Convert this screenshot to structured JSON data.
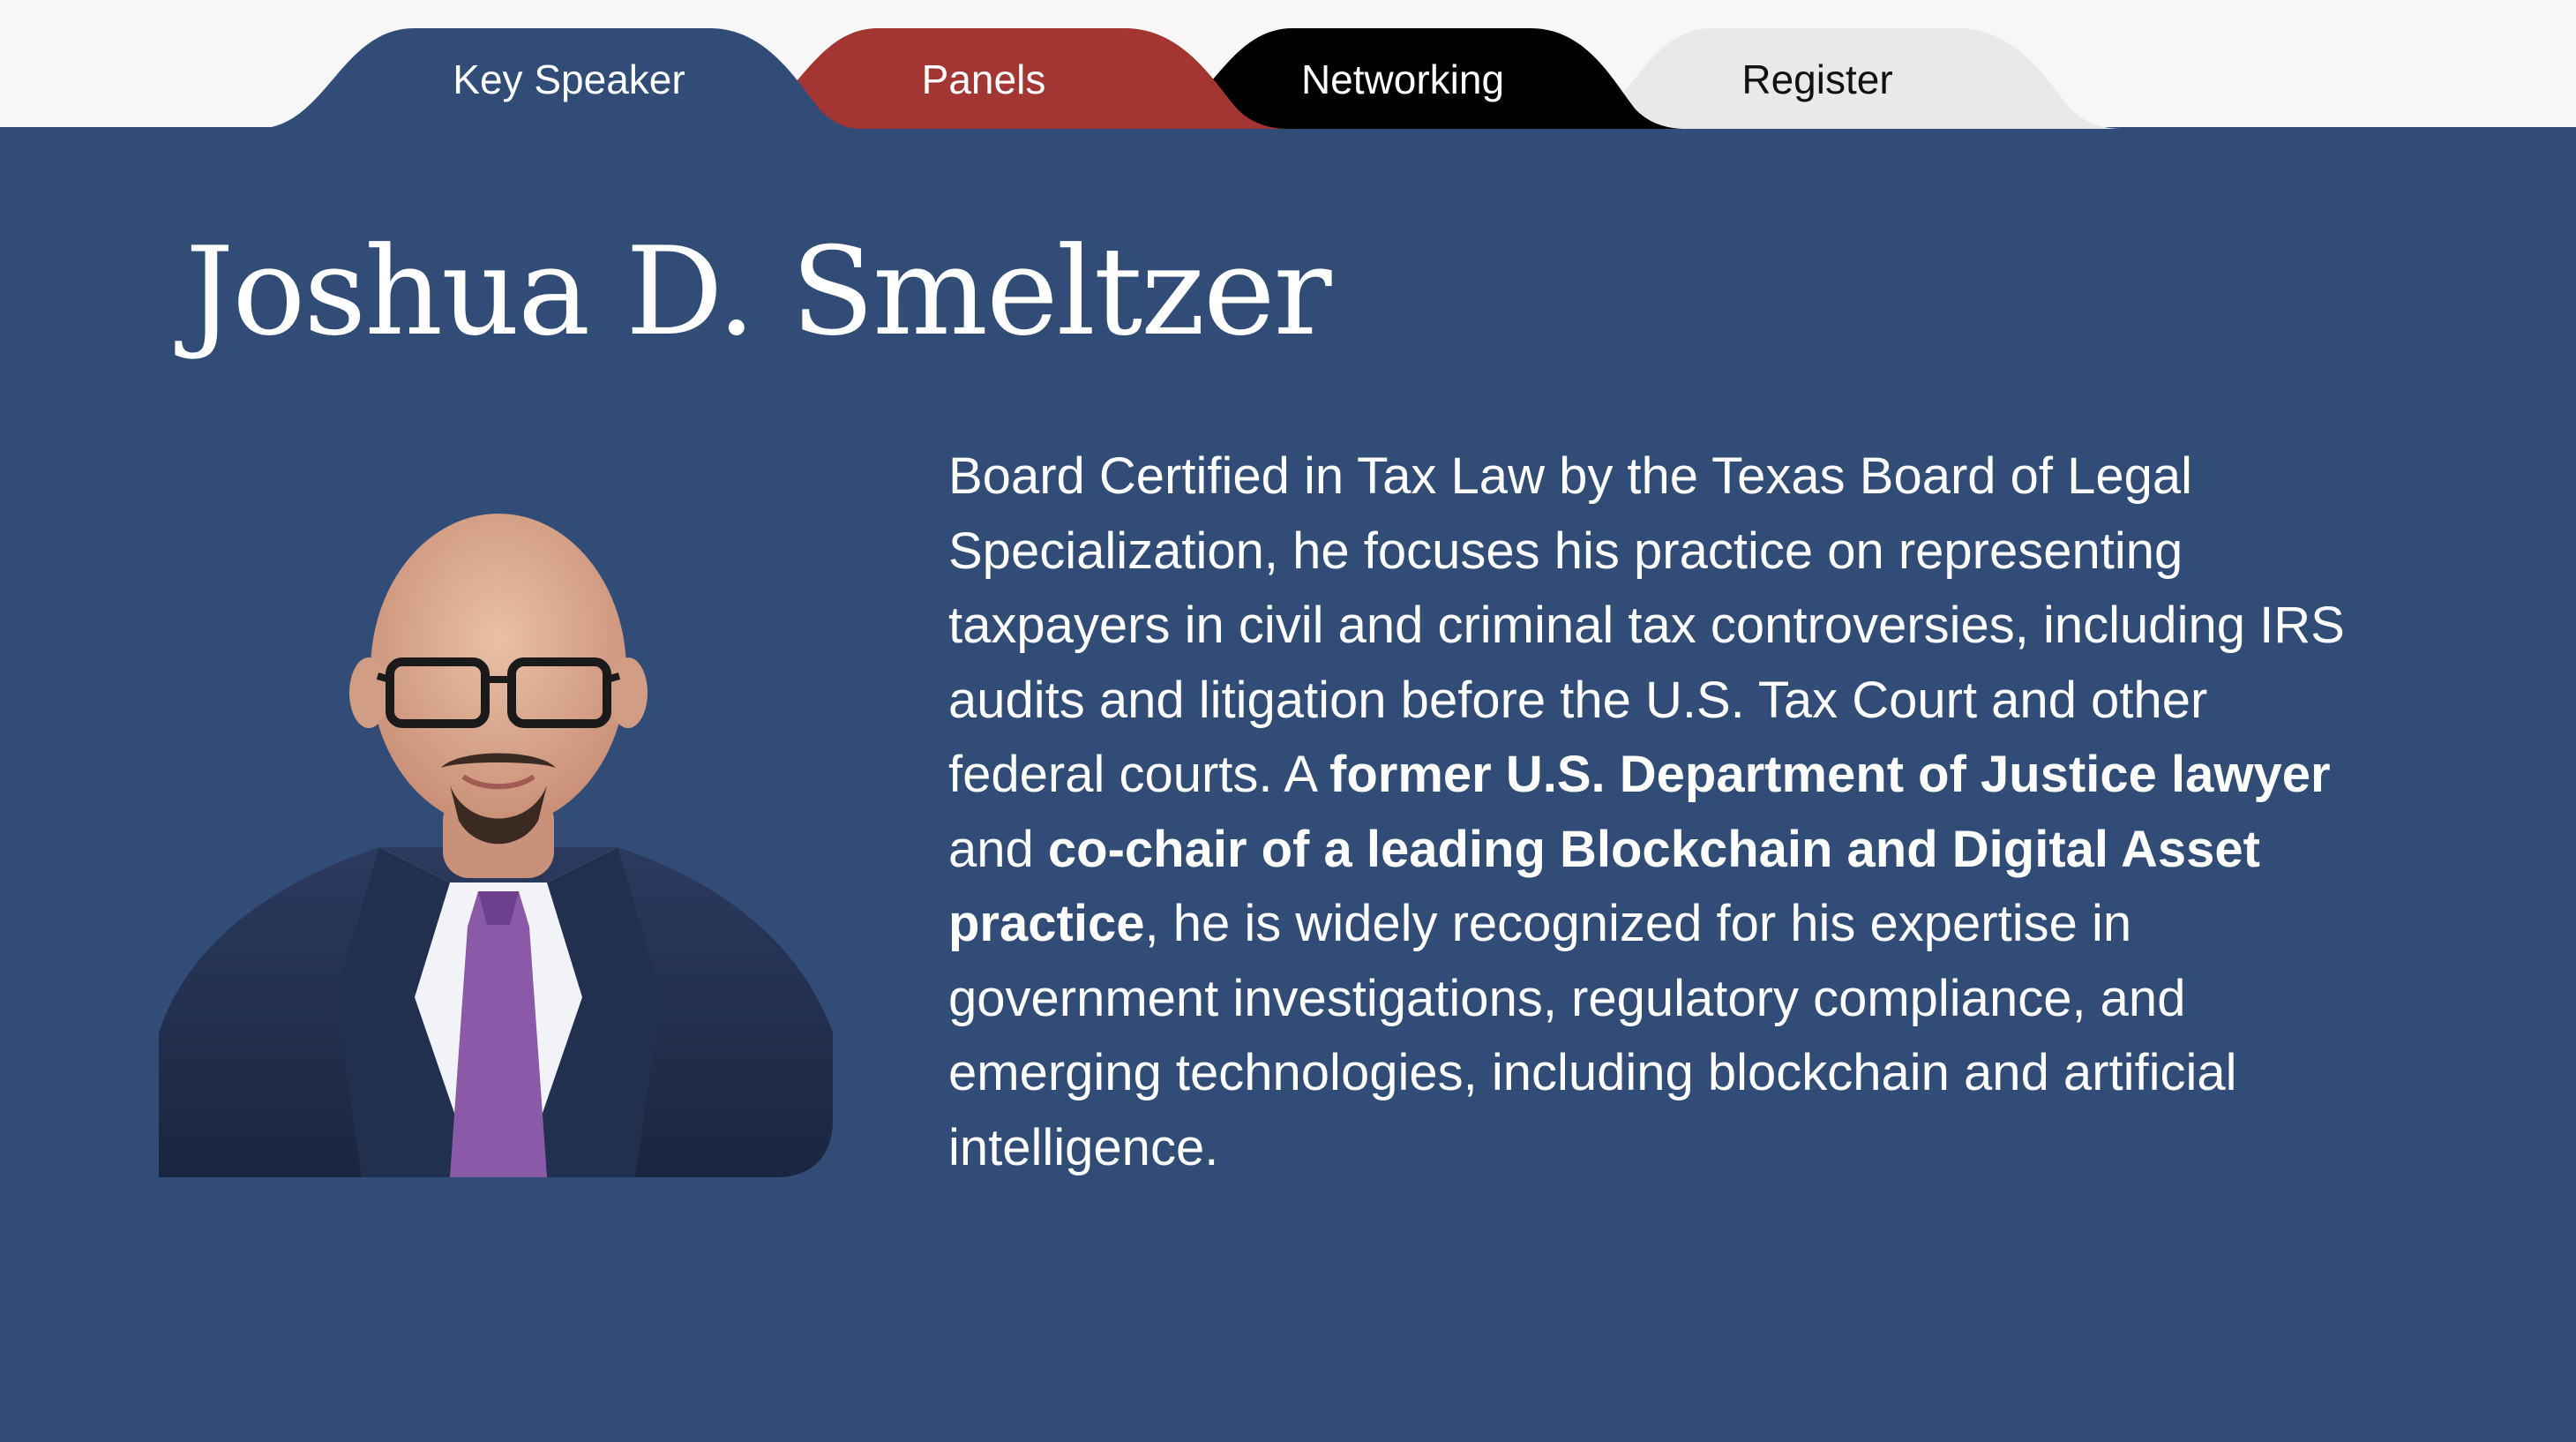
{
  "nav": {
    "tabs": [
      {
        "label": "Key Speaker",
        "color": "#304c77",
        "text_color": "#ffffff",
        "active": true
      },
      {
        "label": "Panels",
        "color": "#a33533",
        "text_color": "#ffffff",
        "active": false
      },
      {
        "label": "Networking",
        "color": "#000000",
        "text_color": "#ffffff",
        "active": false
      },
      {
        "label": "Register",
        "color": "#e9e9e9",
        "text_color": "#111111",
        "active": false
      }
    ]
  },
  "speaker": {
    "name": "Joshua D. Smeltzer",
    "photo_icon": "speaker-portrait",
    "bio": {
      "p1": "Board Certified in Tax Law by the Texas Board of Legal Specialization, he focuses his practice on representing taxpayers in civil and criminal tax controversies, including IRS audits and litigation before the U.S. Tax Court and other federal courts. A ",
      "b1": "former U.S. Department of Justice lawyer",
      "p2": " and ",
      "b2": "co-chair of a leading Blockchain and Digital Asset practice",
      "p3": ", he is widely recognized for his expertise in government investigations, regulatory compliance, and emerging technologies, including blockchain and artificial intelligence."
    }
  },
  "colors": {
    "panel": "#304c77",
    "topbar": "#f7f7f7"
  }
}
